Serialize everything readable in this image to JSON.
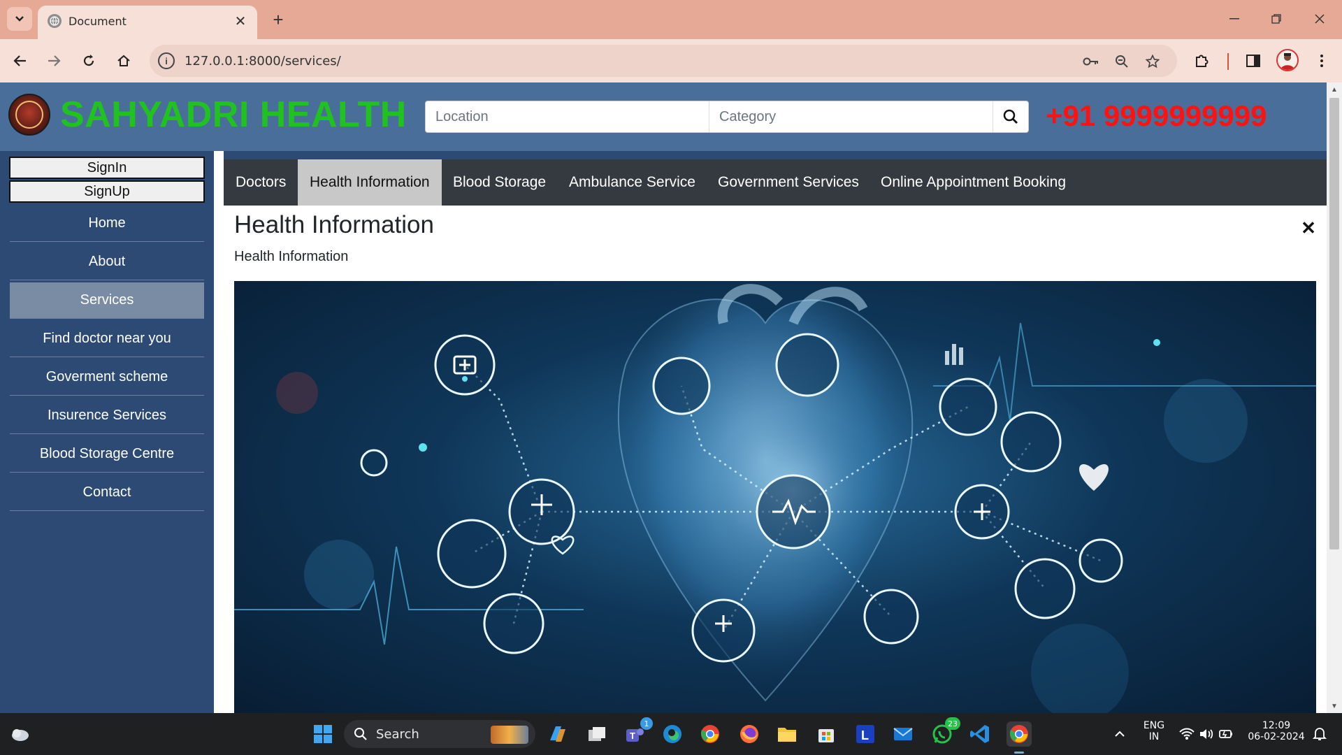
{
  "browser": {
    "tab_title": "Document",
    "url": "127.0.0.1:8000/services/"
  },
  "header": {
    "brand": "SAHYADRI HEALTH",
    "search_location_placeholder": "Location",
    "search_category_placeholder": "Category",
    "phone": "+91 9999999999"
  },
  "sidebar": {
    "signin": "SignIn",
    "signup": "SignUp",
    "items": [
      {
        "label": "Home"
      },
      {
        "label": "About"
      },
      {
        "label": "Services",
        "active": true
      },
      {
        "label": "Find doctor near you"
      },
      {
        "label": "Goverment scheme"
      },
      {
        "label": "Insurence Services"
      },
      {
        "label": "Blood Storage Centre"
      },
      {
        "label": "Contact"
      }
    ]
  },
  "services_tabs": [
    {
      "label": "Doctors"
    },
    {
      "label": "Health Information",
      "active": true
    },
    {
      "label": "Blood Storage"
    },
    {
      "label": "Ambulance Service"
    },
    {
      "label": "Government Services"
    },
    {
      "label": "Online Appointment Booking"
    }
  ],
  "panel": {
    "title": "Health Information",
    "subtitle": "Health Information",
    "close": "✕"
  },
  "taskbar": {
    "search_label": "Search",
    "teams_badge": "1",
    "whatsapp_badge": "23",
    "lang_line1": "ENG",
    "lang_line2": "IN",
    "time": "12:09",
    "date": "06-02-2024"
  },
  "colors": {
    "header_bg": "#4a6e9a",
    "sidebar_bg": "#2c4a73",
    "brand_green": "#1fc21f",
    "phone_red": "#ff1111",
    "tabs_bg": "#343a40",
    "active_tab_bg": "#c8c8c8"
  }
}
